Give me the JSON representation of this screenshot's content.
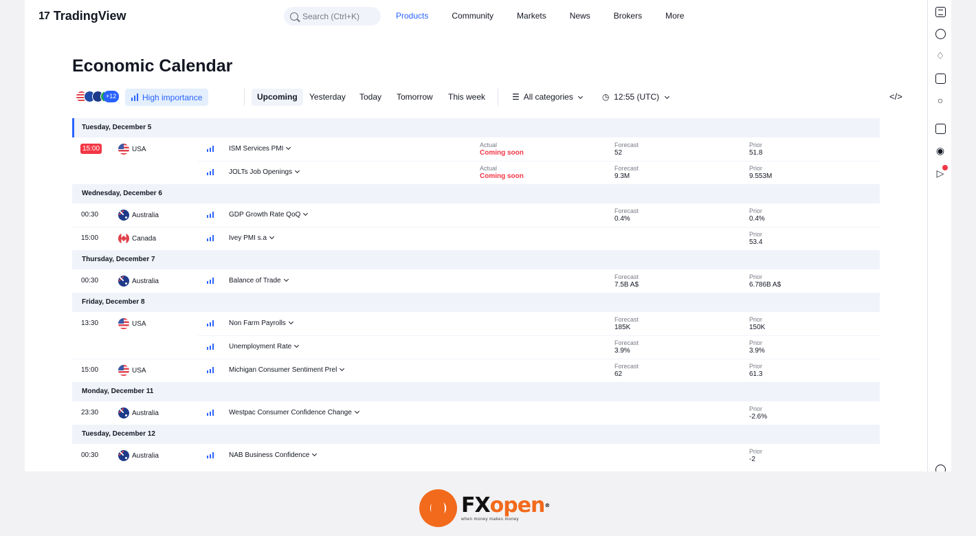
{
  "nav": {
    "logo": "TradingView",
    "logo_mark": "17",
    "search_placeholder": "Search (Ctrl+K)",
    "items": [
      "Products",
      "Community",
      "Markets",
      "News",
      "Brokers",
      "More"
    ],
    "active": "Products"
  },
  "page": {
    "title": "Economic Calendar"
  },
  "toolbar": {
    "plus_count": "+12",
    "importance": "High importance",
    "periods": [
      "Upcoming",
      "Yesterday",
      "Today",
      "Tomorrow",
      "This week"
    ],
    "selected_period": "Upcoming",
    "categories": "All categories",
    "time": "12:55 (UTC)",
    "embed_symbol": "</>"
  },
  "colors": {
    "accent": "#2962ff",
    "danger": "#f23645",
    "brand_orange": "#f26a1b"
  },
  "labels": {
    "actual": "Actual",
    "forecast": "Forecast",
    "prior": "Prior"
  },
  "days": [
    {
      "date": "Tuesday, December 5",
      "events": [
        {
          "time": "15:00",
          "time_badge": true,
          "country": "USA",
          "flag": "us",
          "name": "ISM Services PMI",
          "actual": "Coming soon",
          "forecast": "52",
          "prior": "51.8"
        },
        {
          "time": "",
          "country": "",
          "flag": "",
          "name": "JOLTs Job Openings",
          "actual": "Coming soon",
          "forecast": "9.3M",
          "prior": "9.553M"
        }
      ]
    },
    {
      "date": "Wednesday, December 6",
      "events": [
        {
          "time": "00:30",
          "country": "Australia",
          "flag": "au",
          "name": "GDP Growth Rate QoQ",
          "actual": "",
          "forecast": "0.4%",
          "prior": "0.4%"
        },
        {
          "time": "15:00",
          "country": "Canada",
          "flag": "ca",
          "name": "Ivey PMI s.a",
          "actual": "",
          "forecast": "",
          "prior": "53.4"
        }
      ]
    },
    {
      "date": "Thursday, December 7",
      "events": [
        {
          "time": "00:30",
          "country": "Australia",
          "flag": "au",
          "name": "Balance of Trade",
          "actual": "",
          "forecast": "7.5B A$",
          "prior": "6.786B A$"
        }
      ]
    },
    {
      "date": "Friday, December 8",
      "events": [
        {
          "time": "13:30",
          "country": "USA",
          "flag": "us",
          "name": "Non Farm Payrolls",
          "actual": "",
          "forecast": "185K",
          "prior": "150K"
        },
        {
          "time": "",
          "country": "",
          "flag": "",
          "name": "Unemployment Rate",
          "actual": "",
          "forecast": "3.9%",
          "prior": "3.9%"
        },
        {
          "time": "15:00",
          "country": "USA",
          "flag": "us",
          "name": "Michigan Consumer Sentiment Prel",
          "actual": "",
          "forecast": "62",
          "prior": "61.3"
        }
      ]
    },
    {
      "date": "Monday, December 11",
      "events": [
        {
          "time": "23:30",
          "country": "Australia",
          "flag": "au",
          "name": "Westpac Consumer Confidence Change",
          "actual": "",
          "forecast": "",
          "prior": "-2.6%"
        }
      ]
    },
    {
      "date": "Tuesday, December 12",
      "events": [
        {
          "time": "00:30",
          "country": "Australia",
          "flag": "au",
          "name": "NAB Business Confidence",
          "actual": "",
          "forecast": "",
          "prior": "-2"
        }
      ]
    }
  ],
  "sidebar_icons": [
    "watchlist-icon",
    "alert-clock-icon",
    "hotlist-icon",
    "calendar-icon",
    "ideas-icon",
    "chat-icon",
    "streams-icon",
    "notifications-icon",
    "help-icon"
  ],
  "brand": {
    "fx": "FX",
    "open": "open",
    "reg": "®",
    "tagline": "when money makes money"
  }
}
